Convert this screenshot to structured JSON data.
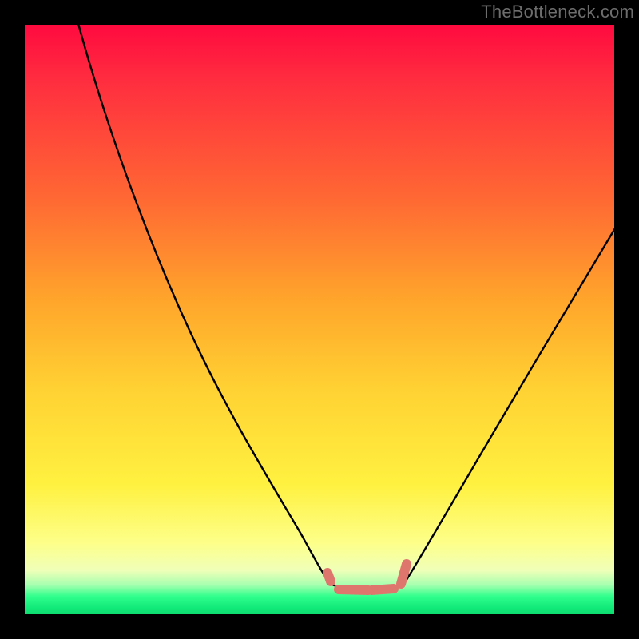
{
  "watermark": "TheBottleneck.com",
  "colors": {
    "frame": "#000000",
    "curve": "#000000",
    "marker": "#df766d",
    "gradient_stops": [
      "#ff0a3f",
      "#ff2f3f",
      "#ff6a33",
      "#ffa62b",
      "#ffd233",
      "#fff140",
      "#fdff8a",
      "#f0ffb8",
      "#a8ffb0",
      "#2fff8c",
      "#10e878",
      "#0fdc70"
    ]
  },
  "chart_data": {
    "type": "line",
    "title": "",
    "xlabel": "",
    "ylabel": "",
    "x_range": [
      0,
      100
    ],
    "y_range": [
      0,
      100
    ],
    "series": [
      {
        "name": "left-branch",
        "x": [
          9,
          15,
          20,
          25,
          30,
          35,
          40,
          45,
          49,
          52
        ],
        "y": [
          100,
          90,
          80,
          70,
          60,
          50,
          39,
          25,
          11,
          5
        ]
      },
      {
        "name": "valley",
        "x": [
          52,
          55,
          58,
          61,
          64
        ],
        "y": [
          5,
          4.5,
          4.5,
          4.6,
          5
        ]
      },
      {
        "name": "right-branch",
        "x": [
          64,
          68,
          72,
          78,
          84,
          90,
          96,
          100
        ],
        "y": [
          5,
          12,
          20,
          32,
          43,
          53,
          63,
          69
        ]
      }
    ],
    "markers": {
      "name": "valley-markers",
      "x": [
        52,
        55,
        58,
        60.5,
        62,
        64,
        64.2
      ],
      "y": [
        6,
        4.5,
        4.5,
        4.5,
        4.6,
        5.5,
        8
      ]
    }
  }
}
